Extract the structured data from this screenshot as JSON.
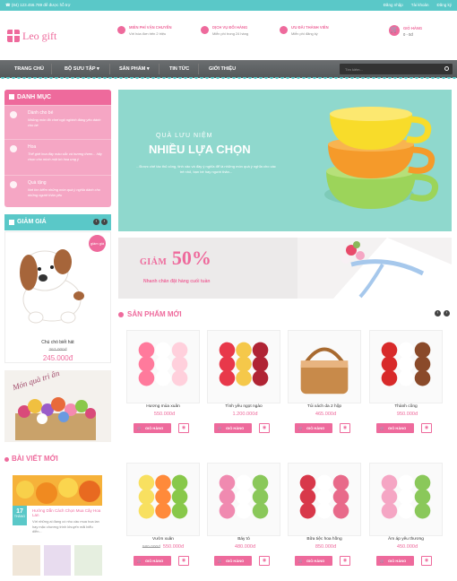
{
  "topbar": {
    "contact": "☎ (84) 123.456.789 để được hỗ trợ",
    "links": [
      "Đăng nhập",
      "Tài khoản",
      "Đăng ký"
    ]
  },
  "header": {
    "logo": "Leo gift",
    "services": [
      {
        "title": "MIỄN PHÍ VẬN CHUYỂN",
        "sub": "Với hóa đơn trên 2 triệu"
      },
      {
        "title": "DỊCH VỤ ĐỔI HÀNG",
        "sub": "Miễn phí trong 24 hàng"
      },
      {
        "title": "ƯU ĐÃI THÀNH VIÊN",
        "sub": "Miễn phí đăng ký"
      }
    ],
    "cart_title": "GIỎ HÀNG",
    "cart_value": "0 - 0đ"
  },
  "nav": {
    "items": [
      "TRANG CHỦ",
      "BỘ SƯU TẬP",
      "SẢN PHẨM",
      "TIN TỨC",
      "GIỚI THIỆU"
    ],
    "search_placeholder": "Tìm kiếm..."
  },
  "sidebar": {
    "category_title": "DANH MỤC",
    "categories": [
      {
        "title": "Dành cho bé",
        "desc": "Những món đồ chơi ngộ nghinh đáng yêu dành cho bé"
      },
      {
        "title": "Hoa",
        "desc": "Thế giới hoa đầy màu sắc và hương thơm... hãy chọn cho mình một bó hoa ưng ý"
      },
      {
        "title": "Quà tặng",
        "desc": "Nơi tìm kiếm những món quà ý nghĩa dành cho những người thân yêu"
      }
    ],
    "sale_title": "GIẢM GIÁ",
    "sale_badge": "giảm giá",
    "sale_product": {
      "name": "Chú chó biết hát",
      "old_price": "267.000đ",
      "price": "245.000đ"
    },
    "banner_text": "Món quà tri ân",
    "blog_title": "BÀI VIẾT MỚI",
    "blog": {
      "day": "17",
      "month": "THÁNG",
      "title": "Hướng Dẫn Cách Chọn Mua Cây Hoa Lan",
      "excerpt": "Với những ai đang có nhu cầu mua hoa lan hay mặc chương trình khuyến mãi biểu diễn..."
    }
  },
  "hero": {
    "sub": "QUÀ LƯU NIỆM",
    "title": "NHIỀU LỰA CHỌN",
    "desc": "...Được chế tác thủ công, tinh xảo và đầy ý nghĩa để là những món quà ý nghĩa cho các trẻ nhỏ, bạn bè hay người thân..."
  },
  "promo": {
    "label": "GIẢM",
    "value": "50%",
    "sub": "Nhanh chân đặt hàng cuối tuần"
  },
  "products": {
    "title": "SẢN PHẨM MỚI",
    "buy_label": "GIỎ HÀNG",
    "items": [
      {
        "name": "Hương mùa xuân",
        "old": "",
        "price": "550.000đ"
      },
      {
        "name": "Tình yêu ngọt ngào",
        "old": "",
        "price": "1.200.000đ"
      },
      {
        "name": "Túi xách da 2 hộp",
        "old": "",
        "price": "465.000đ"
      },
      {
        "name": "Thành công",
        "old": "",
        "price": "950.000đ"
      },
      {
        "name": "Vườn xuân",
        "old": "580.000đ",
        "price": "550.000đ"
      },
      {
        "name": "Báy tỏ",
        "old": "",
        "price": "480.000đ"
      },
      {
        "name": "Bữa tiệc hoa hồng",
        "old": "",
        "price": "850.000đ"
      },
      {
        "name": "Âm áp yêu thương",
        "old": "",
        "price": "450.000đ"
      }
    ]
  }
}
